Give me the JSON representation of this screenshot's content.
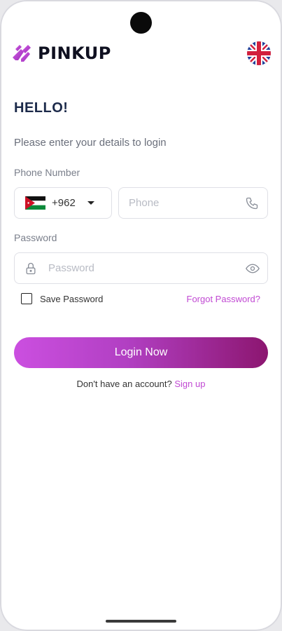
{
  "app": {
    "brand_name": "PINKUP",
    "language_flag": "uk-flag-icon"
  },
  "login": {
    "heading": "HELLO!",
    "subtitle": "Please enter your details to login",
    "phone_label": "Phone Number",
    "country_code": "+962",
    "country_flag": "jordan-flag-icon",
    "phone_placeholder": "Phone",
    "password_label": "Password",
    "password_placeholder": "Password",
    "save_password_label": "Save Password",
    "save_password_checked": false,
    "forgot_password": "Forgot Password?",
    "login_button": "Login Now",
    "no_account_text": "Don't have an account?",
    "signup_link": "Sign up"
  },
  "colors": {
    "accent": "#c14ad3",
    "button_gradient_start": "#cb4fe0",
    "button_gradient_end": "#8c1670",
    "heading": "#1c2a4a"
  }
}
